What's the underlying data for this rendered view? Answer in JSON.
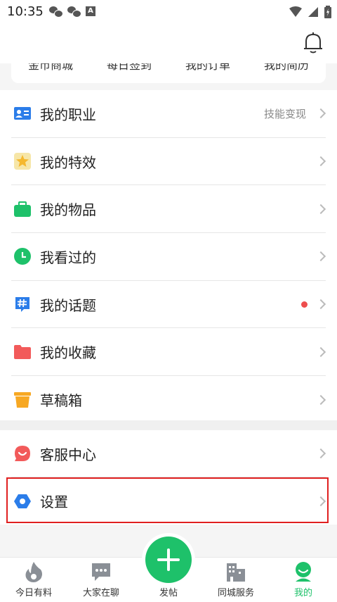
{
  "status": {
    "time": "10:35",
    "a_label": "A"
  },
  "quick_links": [
    "金币商城",
    "每日签到",
    "我的订单",
    "我的简历"
  ],
  "menu": [
    {
      "label": "我的职业",
      "extra": "技能变现",
      "icon": "id-card-icon"
    },
    {
      "label": "我的特效",
      "icon": "star-sparkle-icon"
    },
    {
      "label": "我的物品",
      "icon": "briefcase-icon"
    },
    {
      "label": "我看过的",
      "icon": "clock-icon"
    },
    {
      "label": "我的话题",
      "icon": "hashtag-icon",
      "has_dot": true
    },
    {
      "label": "我的收藏",
      "icon": "folder-icon"
    },
    {
      "label": "草稿箱",
      "icon": "draft-box-icon"
    }
  ],
  "menu2": [
    {
      "label": "客服中心",
      "icon": "customer-service-icon"
    },
    {
      "label": "设置",
      "icon": "settings-hexagon-icon"
    }
  ],
  "tabs": [
    {
      "label": "今日有料",
      "icon": "flame-icon"
    },
    {
      "label": "大家在聊",
      "icon": "chat-bubble-icon"
    },
    {
      "label": "发帖",
      "icon": "plus-icon"
    },
    {
      "label": "同城服务",
      "icon": "buildings-icon"
    },
    {
      "label": "我的",
      "icon": "profile-icon",
      "active": true
    }
  ],
  "colors": {
    "accent": "#1ec16a",
    "highlight": "#e02020"
  }
}
